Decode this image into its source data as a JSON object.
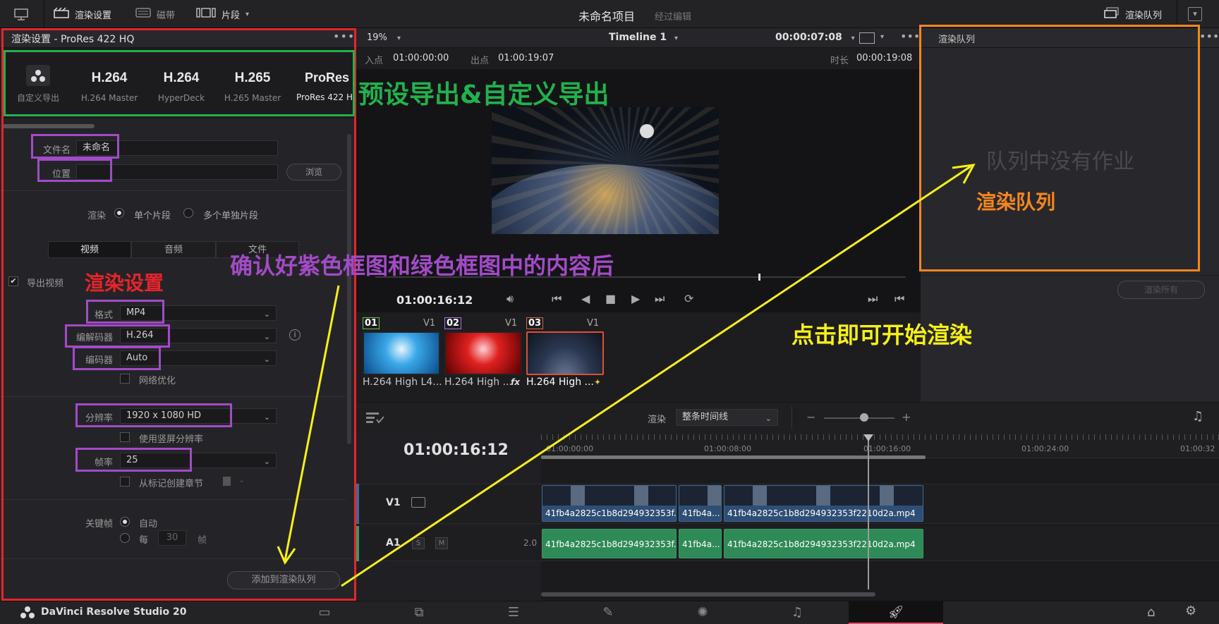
{
  "topbar": {
    "render_settings": "渲染设置",
    "tape": "磁带",
    "clips": "片段",
    "project_title": "未命名项目",
    "edit_status": "经过编辑",
    "render_queue": "渲染队列"
  },
  "render_settings": {
    "panel_title": "渲染设置 - ProRes 422 HQ",
    "presets": [
      {
        "big": "",
        "small": "自定义导出"
      },
      {
        "big": "H.264",
        "small": "H.264 Master"
      },
      {
        "big": "H.264",
        "small": "HyperDeck"
      },
      {
        "big": "H.265",
        "small": "H.265 Master"
      },
      {
        "big": "ProRes",
        "small": "ProRes 422 HQ"
      }
    ],
    "filename_label": "文件名",
    "filename_value": "未命名",
    "location_label": "位置",
    "browse": "浏览",
    "render_label": "渲染",
    "single_clip": "单个片段",
    "multiple_clips": "多个单独片段",
    "tabs": [
      "视频",
      "音频",
      "文件"
    ],
    "export_video": "导出视频",
    "format_label": "格式",
    "format_value": "MP4",
    "codec_label": "编解码器",
    "codec_value": "H.264",
    "encoder_label": "编码器",
    "encoder_value": "Auto",
    "network_opt": "网络优化",
    "resolution_label": "分辨率",
    "resolution_value": "1920 x 1080 HD",
    "vertical_res": "使用竖屏分辨率",
    "framerate_label": "帧率",
    "framerate_value": "25",
    "chapters": "从标记创建章节",
    "keyframe_label": "关键帧",
    "keyframe_auto": "自动",
    "keyframe_every": "每",
    "keyframe_value": "30",
    "keyframe_unit": "帧",
    "add_to_queue": "添加到渲染队列"
  },
  "viewer": {
    "zoom": "19%",
    "timeline_name": "Timeline 1",
    "timecode_top": "00:00:07:08",
    "in_label": "入点",
    "in_value": "01:00:00:00",
    "out_label": "出点",
    "out_value": "01:00:19:07",
    "duration_label": "时长",
    "duration_value": "00:00:19:08",
    "current_tc": "01:00:16:12"
  },
  "thumbnails": [
    {
      "num": "01",
      "track": "V1",
      "label": "H.264 High L4...",
      "num_color": "#6bbf4f"
    },
    {
      "num": "02",
      "track": "V1",
      "label": "H.264 High ...",
      "num_color": "#b070e0"
    },
    {
      "num": "03",
      "track": "V1",
      "label": "H.264 High ...",
      "num_color": "#e06040"
    }
  ],
  "render_queue": {
    "title": "渲染队列",
    "empty": "队列中没有作业",
    "render_all": "渲染所有"
  },
  "timeline": {
    "render_label": "渲染",
    "render_mode": "整条时间线",
    "timecode": "01:00:16:12",
    "ruler_marks": [
      "01:00:00:00",
      "01:00:08:00",
      "01:00:16:00",
      "01:00:24:00",
      "01:00:32"
    ],
    "v1": "V1",
    "a1": "A1",
    "a1_level": "2.0",
    "a1_s": "S",
    "a1_m": "M",
    "clips_v": [
      "41fb4a2825c1b8d294932353f...",
      "41fb4a...",
      "41fb4a2825c1b8d294932353f2210d2a.mp4"
    ],
    "clips_a": [
      "41fb4a2825c1b8d294932353f...",
      "41fb4a...",
      "41fb4a2825c1b8d294932353f2210d2a.mp4"
    ]
  },
  "bottombar": {
    "app_name": "DaVinci Resolve Studio 20"
  },
  "annotations": {
    "preset_export": "预设导出&自定义导出",
    "render_settings": "渲染设置",
    "confirm": "确认好紫色框图和绿色框图中的内容后",
    "render_queue": "渲染队列",
    "click_start": "点击即可开始渲染",
    "colors": {
      "red": "#e8242a",
      "green": "#22b14c",
      "purple": "#a24bc7",
      "orange": "#f5861f",
      "yellow": "#f7f016"
    }
  }
}
